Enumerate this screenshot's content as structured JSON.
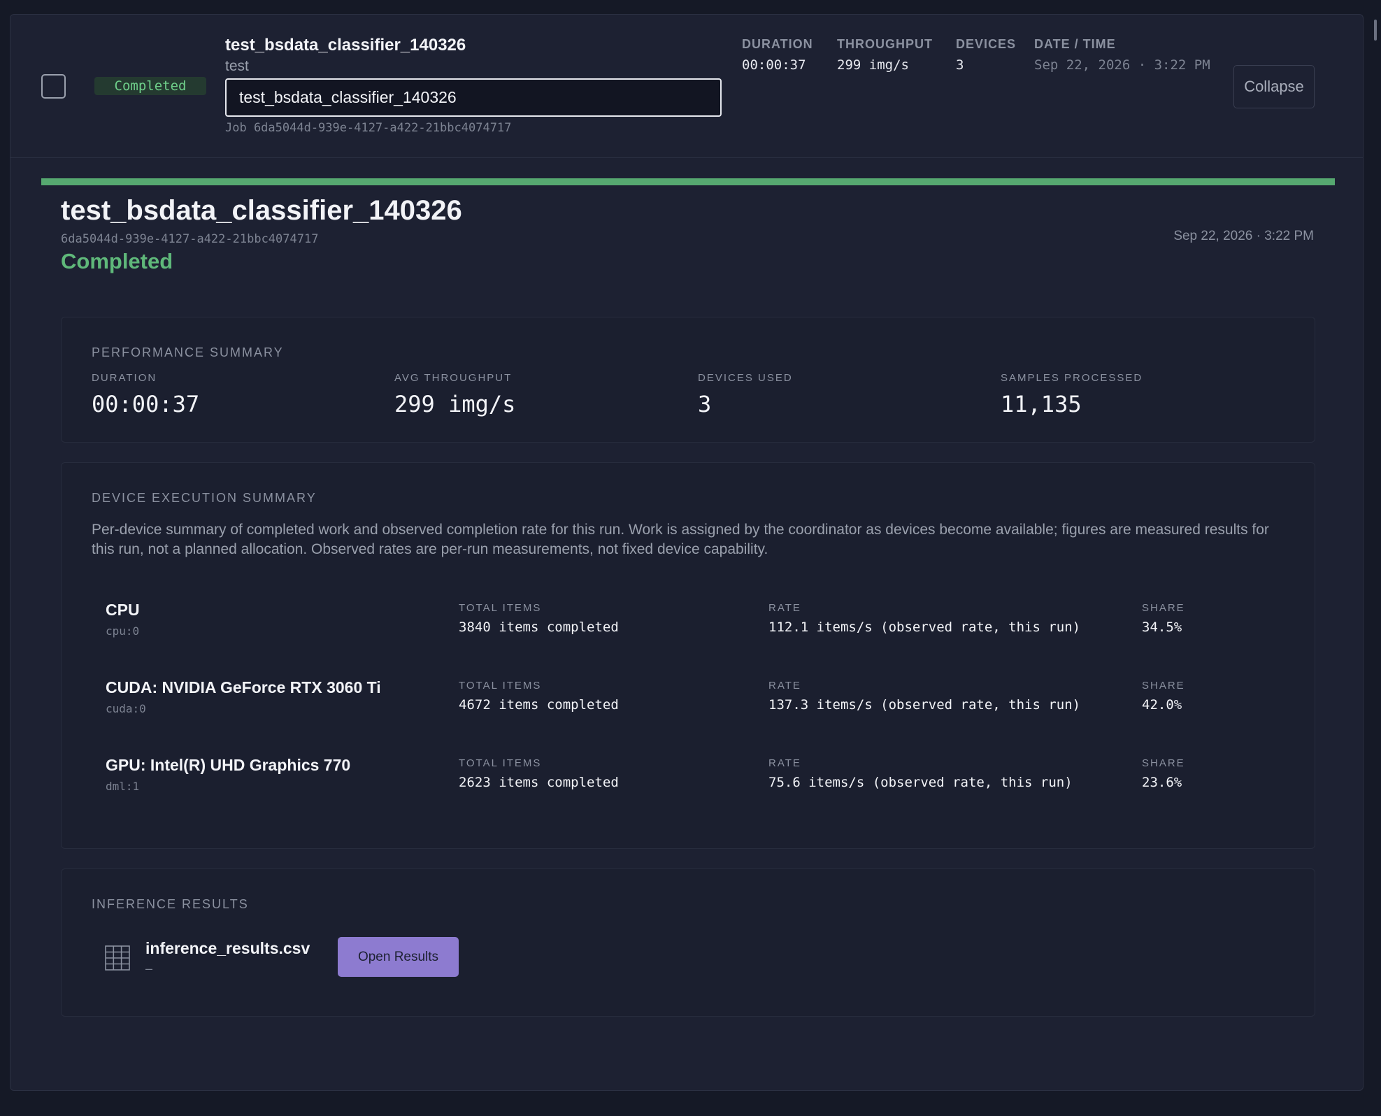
{
  "header": {
    "status": "Completed",
    "title": "test_bsdata_classifier_140326",
    "subtitle": "test",
    "name_input_value": "test_bsdata_classifier_140326",
    "job_id_text": "Job 6da5044d-939e-4127-a422-21bbc4074717",
    "meta": {
      "duration_label": "DURATION",
      "duration_value": "00:00:37",
      "throughput_label": "THROUGHPUT",
      "throughput_value": "299 img/s",
      "devices_label": "DEVICES",
      "devices_value": "3",
      "datetime_label": "DATE / TIME",
      "datetime_value": "Sep 22, 2026 · 3:22 PM"
    },
    "collapse_label": "Collapse"
  },
  "detail": {
    "progress_fraction": 1.0,
    "progress_color": "#56a870",
    "title": "test_bsdata_classifier_140326",
    "id": "6da5044d-939e-4127-a422-21bbc4074717",
    "status": "Completed",
    "datetime": "Sep 22, 2026 · 3:22 PM"
  },
  "performance": {
    "title": "PERFORMANCE SUMMARY",
    "stats": [
      {
        "label": "DURATION",
        "value": "00:00:37"
      },
      {
        "label": "AVG THROUGHPUT",
        "value": "299 img/s"
      },
      {
        "label": "DEVICES USED",
        "value": "3"
      },
      {
        "label": "SAMPLES PROCESSED",
        "value": "11,135"
      }
    ]
  },
  "devices": {
    "title": "DEVICE EXECUTION SUMMARY",
    "description": "Per-device summary of completed work and observed completion rate for this run. Work is assigned by the coordinator as devices become available; figures are measured results for this run, not a planned allocation. Observed rates are per-run measurements, not fixed device capability.",
    "col_labels": {
      "total": "TOTAL ITEMS",
      "rate": "RATE",
      "share": "SHARE"
    },
    "rows": [
      {
        "name": "CPU",
        "id": "cpu:0",
        "total": "3840 items completed",
        "rate": "112.1 items/s (observed rate, this run)",
        "share": "34.5%"
      },
      {
        "name": "CUDA: NVIDIA GeForce RTX 3060 Ti",
        "id": "cuda:0",
        "total": "4672 items completed",
        "rate": "137.3 items/s (observed rate, this run)",
        "share": "42.0%"
      },
      {
        "name": "GPU: Intel(R) UHD Graphics 770",
        "id": "dml:1",
        "total": "2623 items completed",
        "rate": "75.6 items/s (observed rate, this run)",
        "share": "23.6%"
      }
    ]
  },
  "results": {
    "title": "INFERENCE RESULTS",
    "file_icon": "table-grid-icon",
    "file_name": "inference_results.csv",
    "file_sub": "–",
    "open_label": "Open Results"
  }
}
